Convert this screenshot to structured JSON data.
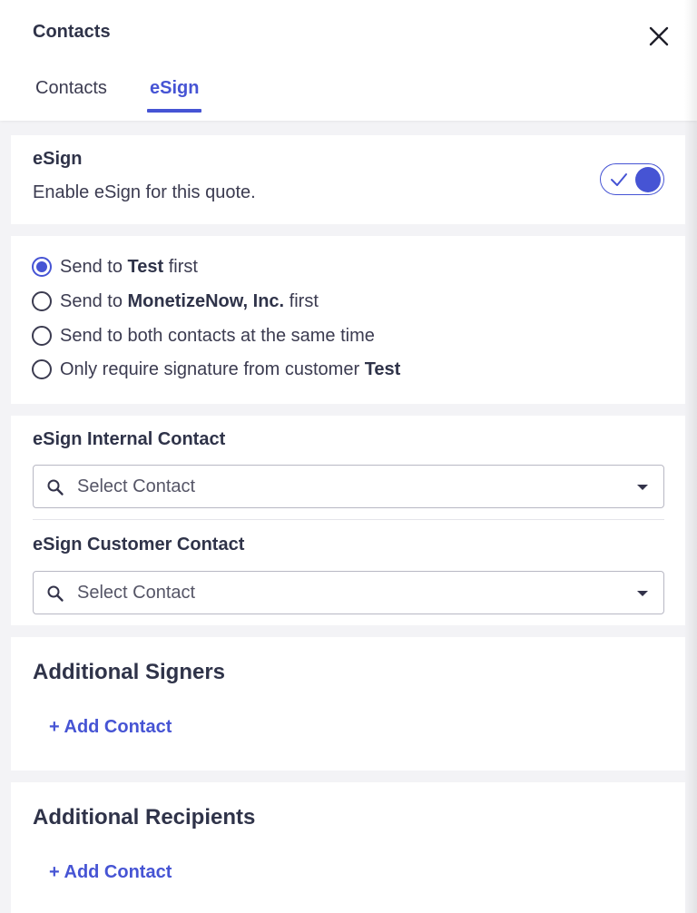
{
  "header": {
    "title": "Contacts",
    "close_icon": "close-icon"
  },
  "tabs": [
    {
      "label": "Contacts",
      "active": false
    },
    {
      "label": "eSign",
      "active": true
    }
  ],
  "esign": {
    "title": "eSign",
    "description": "Enable eSign for this quote.",
    "enabled": true
  },
  "send_options": [
    {
      "prefix": "Send to ",
      "bold": "Test",
      "suffix": " first",
      "selected": true
    },
    {
      "prefix": "Send to ",
      "bold": "MonetizeNow, Inc.",
      "suffix": " first",
      "selected": false
    },
    {
      "prefix": "Send to both contacts at the same time",
      "bold": "",
      "suffix": "",
      "selected": false
    },
    {
      "prefix": "Only require signature from customer ",
      "bold": "Test",
      "suffix": "",
      "selected": false
    }
  ],
  "internal_contact": {
    "label": "eSign Internal Contact",
    "placeholder": "Select Contact"
  },
  "customer_contact": {
    "label": "eSign Customer Contact",
    "placeholder": "Select Contact"
  },
  "additional_signers": {
    "title": "Additional Signers",
    "add_label": "+ Add Contact"
  },
  "additional_recipients": {
    "title": "Additional Recipients",
    "add_label": "+ Add Contact"
  },
  "colors": {
    "accent": "#4654d4",
    "text": "#2f3349",
    "background": "#f3f3f6"
  }
}
